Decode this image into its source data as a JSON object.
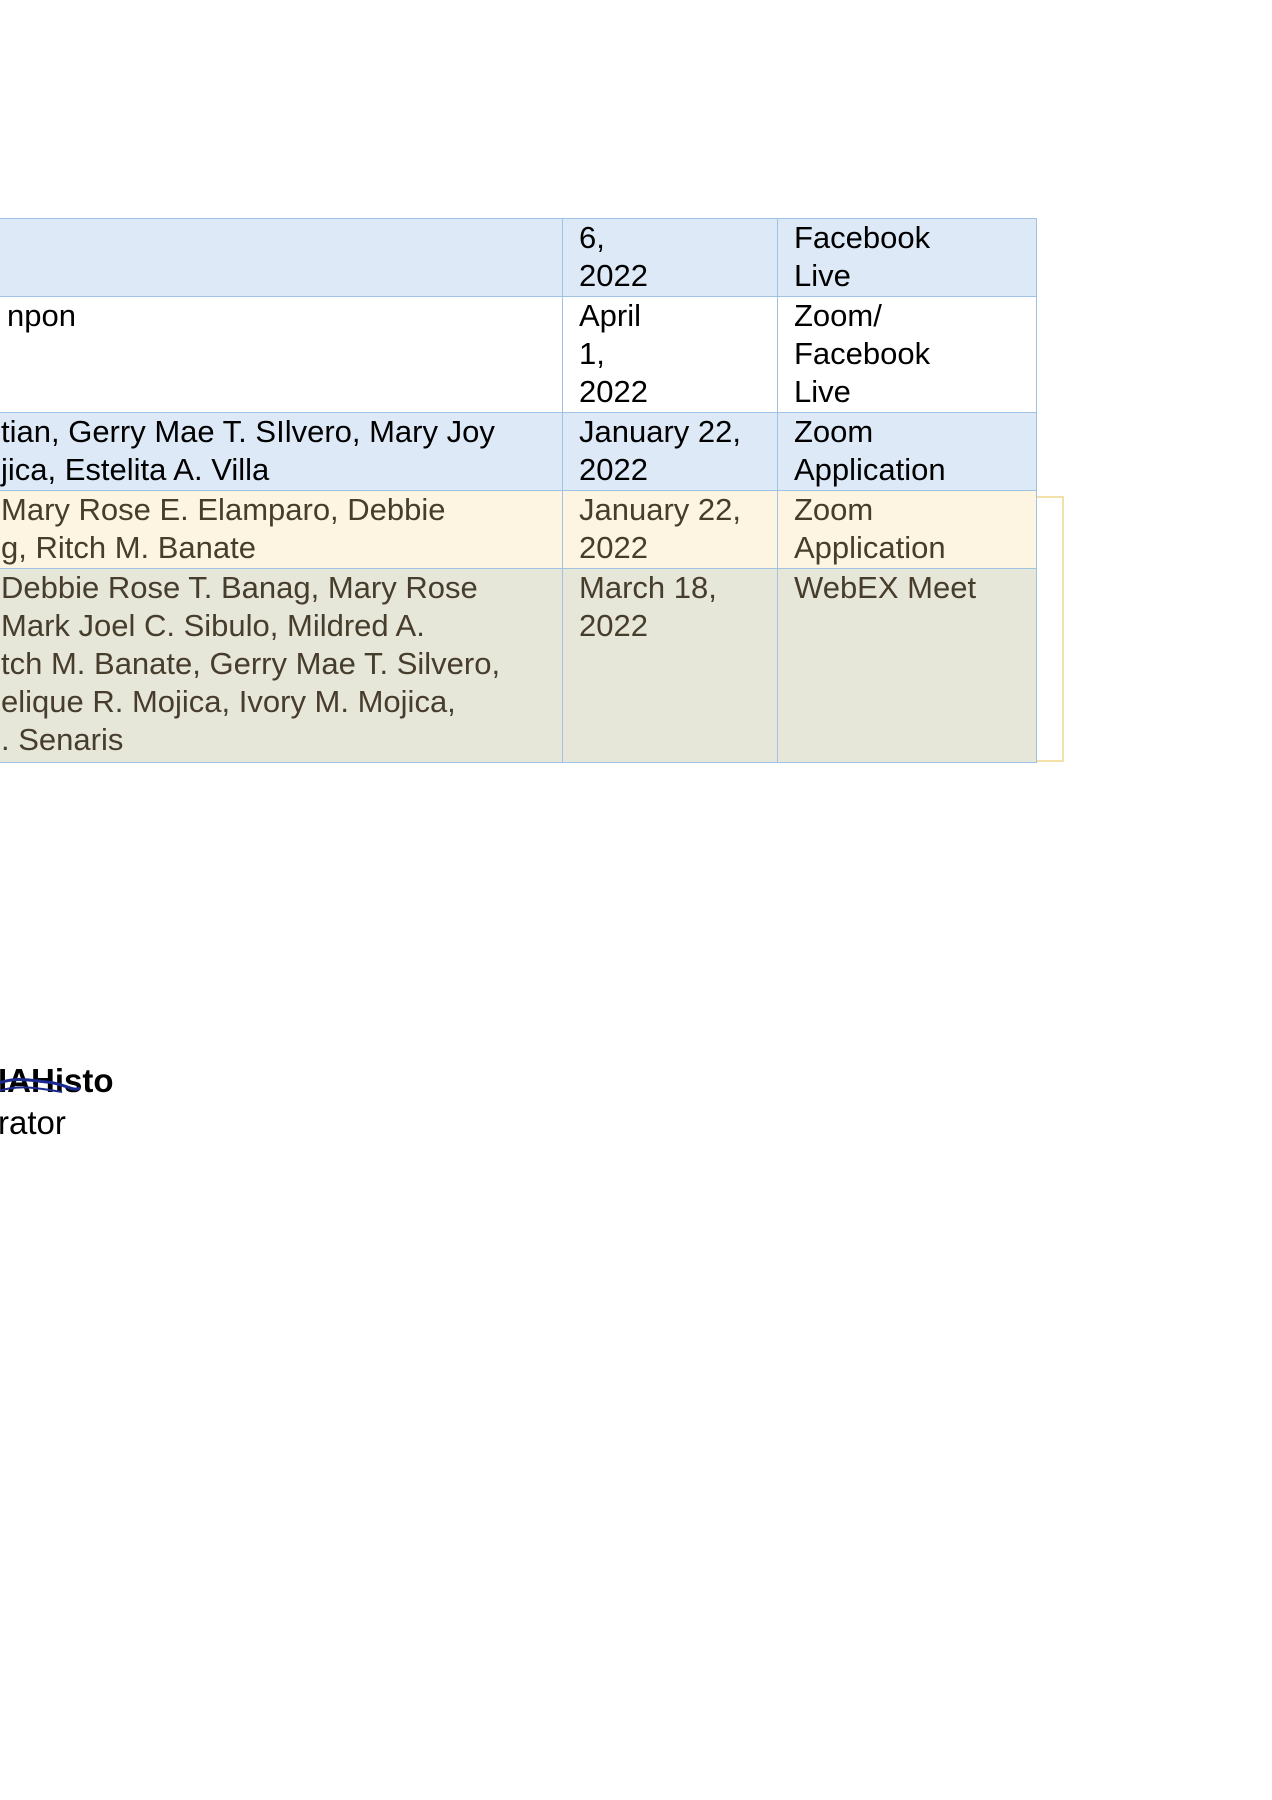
{
  "table": {
    "rows": [
      {
        "names": "",
        "date": "6,\n2022",
        "platform": "Facebook\nLive"
      },
      {
        "names": "npon",
        "date": "April\n1,\n2022",
        "platform": "Zoom/\nFacebook\nLive"
      },
      {
        "names": "tian, Gerry Mae T. SIlvero, Mary Joy\njica, Estelita A. Villa",
        "date": "January 22,\n2022",
        "platform": "Zoom\nApplication"
      },
      {
        "names": " Mary Rose E. Elamparo, Debbie\ng, Ritch M. Banate",
        "date": "January 22,\n2022",
        "platform": "Zoom\nApplication"
      },
      {
        "names": " Debbie Rose T. Banag, Mary Rose\nMark Joel C. Sibulo, Mildred A.\ntch M. Banate, Gerry Mae T. Silvero,\nelique R. Mojica, Ivory M. Mojica,\n. Senaris",
        "date": "March 18,\n2022",
        "platform": "WebEX Meet"
      }
    ]
  },
  "signature": {
    "name": "IAHisto",
    "title": "rator"
  },
  "colors": {
    "border": "#9ec3e4",
    "blue_row": "#dde9f6",
    "cream_row": "#fdf5e2",
    "gray_row": "#e6e6d9",
    "highlight_border": "#f3e2a8",
    "muted_text": "#473d2c",
    "signature_ink": "#1b2a8f"
  }
}
